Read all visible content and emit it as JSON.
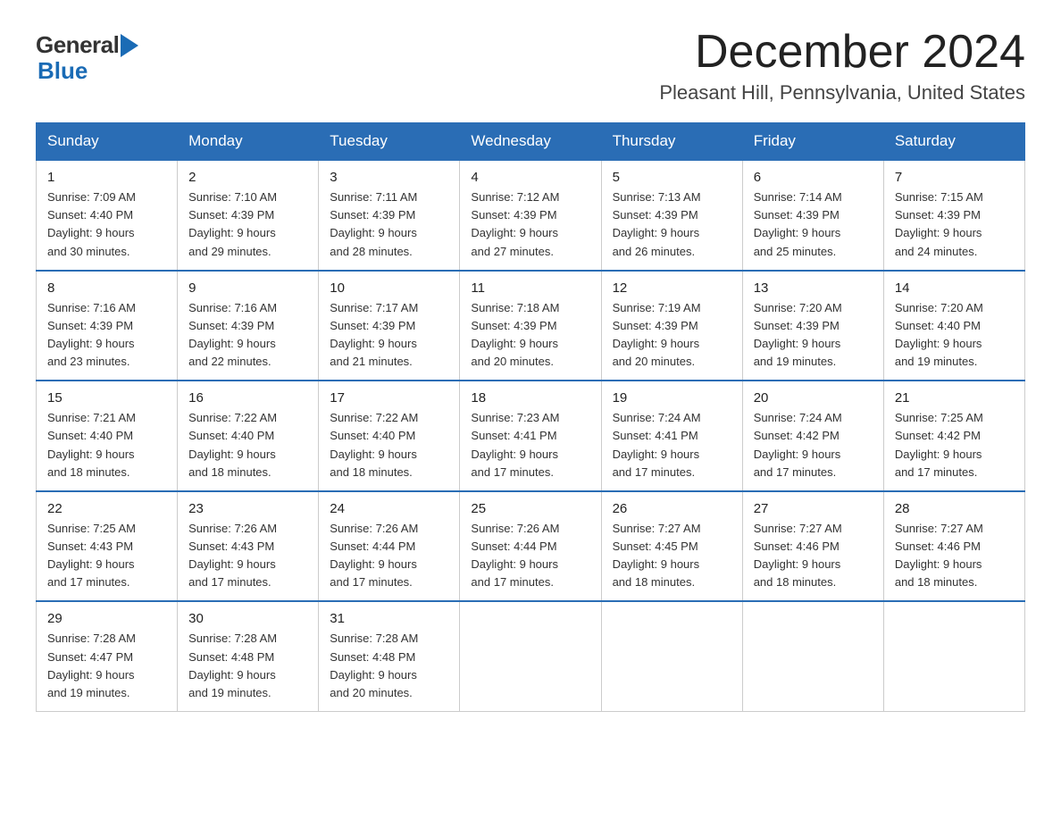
{
  "header": {
    "logo_general": "General",
    "logo_blue": "Blue",
    "month_title": "December 2024",
    "location": "Pleasant Hill, Pennsylvania, United States"
  },
  "weekdays": [
    "Sunday",
    "Monday",
    "Tuesday",
    "Wednesday",
    "Thursday",
    "Friday",
    "Saturday"
  ],
  "weeks": [
    [
      {
        "num": "1",
        "sunrise": "7:09 AM",
        "sunset": "4:40 PM",
        "daylight": "9 hours and 30 minutes."
      },
      {
        "num": "2",
        "sunrise": "7:10 AM",
        "sunset": "4:39 PM",
        "daylight": "9 hours and 29 minutes."
      },
      {
        "num": "3",
        "sunrise": "7:11 AM",
        "sunset": "4:39 PM",
        "daylight": "9 hours and 28 minutes."
      },
      {
        "num": "4",
        "sunrise": "7:12 AM",
        "sunset": "4:39 PM",
        "daylight": "9 hours and 27 minutes."
      },
      {
        "num": "5",
        "sunrise": "7:13 AM",
        "sunset": "4:39 PM",
        "daylight": "9 hours and 26 minutes."
      },
      {
        "num": "6",
        "sunrise": "7:14 AM",
        "sunset": "4:39 PM",
        "daylight": "9 hours and 25 minutes."
      },
      {
        "num": "7",
        "sunrise": "7:15 AM",
        "sunset": "4:39 PM",
        "daylight": "9 hours and 24 minutes."
      }
    ],
    [
      {
        "num": "8",
        "sunrise": "7:16 AM",
        "sunset": "4:39 PM",
        "daylight": "9 hours and 23 minutes."
      },
      {
        "num": "9",
        "sunrise": "7:16 AM",
        "sunset": "4:39 PM",
        "daylight": "9 hours and 22 minutes."
      },
      {
        "num": "10",
        "sunrise": "7:17 AM",
        "sunset": "4:39 PM",
        "daylight": "9 hours and 21 minutes."
      },
      {
        "num": "11",
        "sunrise": "7:18 AM",
        "sunset": "4:39 PM",
        "daylight": "9 hours and 20 minutes."
      },
      {
        "num": "12",
        "sunrise": "7:19 AM",
        "sunset": "4:39 PM",
        "daylight": "9 hours and 20 minutes."
      },
      {
        "num": "13",
        "sunrise": "7:20 AM",
        "sunset": "4:39 PM",
        "daylight": "9 hours and 19 minutes."
      },
      {
        "num": "14",
        "sunrise": "7:20 AM",
        "sunset": "4:40 PM",
        "daylight": "9 hours and 19 minutes."
      }
    ],
    [
      {
        "num": "15",
        "sunrise": "7:21 AM",
        "sunset": "4:40 PM",
        "daylight": "9 hours and 18 minutes."
      },
      {
        "num": "16",
        "sunrise": "7:22 AM",
        "sunset": "4:40 PM",
        "daylight": "9 hours and 18 minutes."
      },
      {
        "num": "17",
        "sunrise": "7:22 AM",
        "sunset": "4:40 PM",
        "daylight": "9 hours and 18 minutes."
      },
      {
        "num": "18",
        "sunrise": "7:23 AM",
        "sunset": "4:41 PM",
        "daylight": "9 hours and 17 minutes."
      },
      {
        "num": "19",
        "sunrise": "7:24 AM",
        "sunset": "4:41 PM",
        "daylight": "9 hours and 17 minutes."
      },
      {
        "num": "20",
        "sunrise": "7:24 AM",
        "sunset": "4:42 PM",
        "daylight": "9 hours and 17 minutes."
      },
      {
        "num": "21",
        "sunrise": "7:25 AM",
        "sunset": "4:42 PM",
        "daylight": "9 hours and 17 minutes."
      }
    ],
    [
      {
        "num": "22",
        "sunrise": "7:25 AM",
        "sunset": "4:43 PM",
        "daylight": "9 hours and 17 minutes."
      },
      {
        "num": "23",
        "sunrise": "7:26 AM",
        "sunset": "4:43 PM",
        "daylight": "9 hours and 17 minutes."
      },
      {
        "num": "24",
        "sunrise": "7:26 AM",
        "sunset": "4:44 PM",
        "daylight": "9 hours and 17 minutes."
      },
      {
        "num": "25",
        "sunrise": "7:26 AM",
        "sunset": "4:44 PM",
        "daylight": "9 hours and 17 minutes."
      },
      {
        "num": "26",
        "sunrise": "7:27 AM",
        "sunset": "4:45 PM",
        "daylight": "9 hours and 18 minutes."
      },
      {
        "num": "27",
        "sunrise": "7:27 AM",
        "sunset": "4:46 PM",
        "daylight": "9 hours and 18 minutes."
      },
      {
        "num": "28",
        "sunrise": "7:27 AM",
        "sunset": "4:46 PM",
        "daylight": "9 hours and 18 minutes."
      }
    ],
    [
      {
        "num": "29",
        "sunrise": "7:28 AM",
        "sunset": "4:47 PM",
        "daylight": "9 hours and 19 minutes."
      },
      {
        "num": "30",
        "sunrise": "7:28 AM",
        "sunset": "4:48 PM",
        "daylight": "9 hours and 19 minutes."
      },
      {
        "num": "31",
        "sunrise": "7:28 AM",
        "sunset": "4:48 PM",
        "daylight": "9 hours and 20 minutes."
      },
      null,
      null,
      null,
      null
    ]
  ],
  "labels": {
    "sunrise": "Sunrise: ",
    "sunset": "Sunset: ",
    "daylight": "Daylight: "
  }
}
